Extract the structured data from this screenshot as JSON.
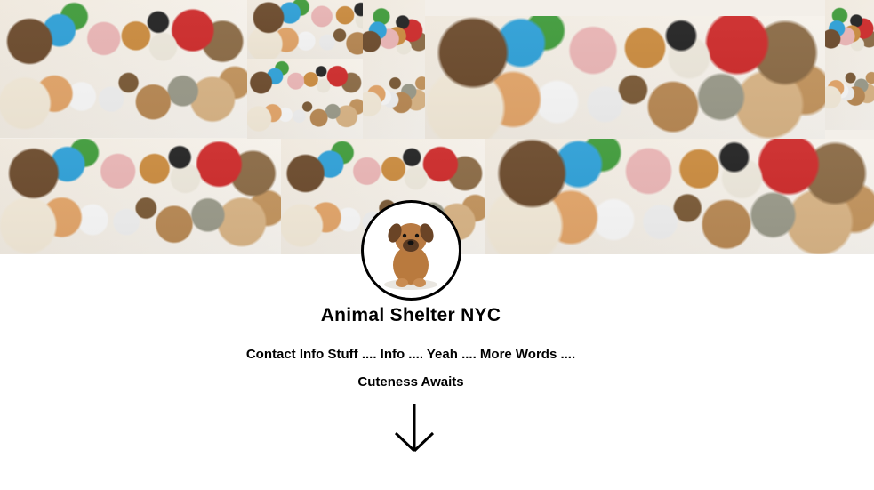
{
  "header": {
    "banner_image": "animal-collage",
    "logo_image": "puppy"
  },
  "main": {
    "title": "Animal Shelter NYC",
    "contact_text": "Contact Info Stuff .... Info .... Yeah .... More Words ....",
    "tagline": "Cuteness Awaits",
    "scroll_icon": "arrow-down-icon"
  },
  "colors": {
    "text": "#000000",
    "background": "#ffffff"
  }
}
